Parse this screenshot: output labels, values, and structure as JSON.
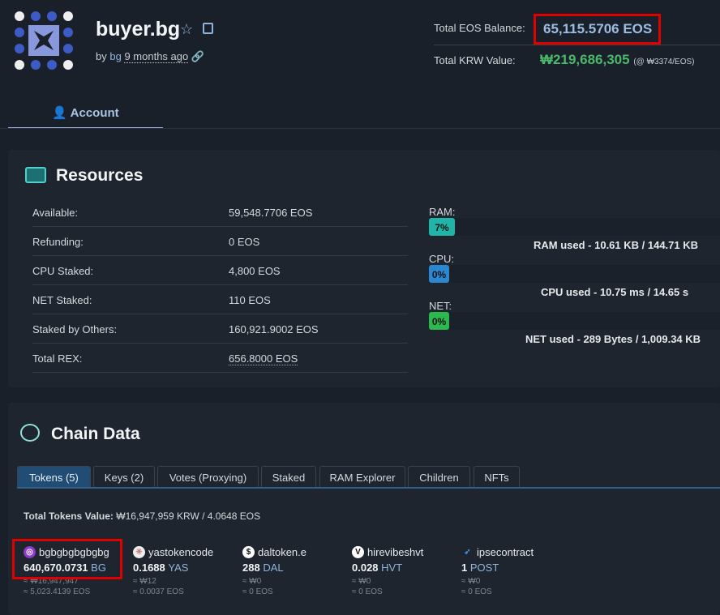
{
  "header": {
    "account": "buyer.bg",
    "by": "by",
    "creator": "bg",
    "age": "9 months ago"
  },
  "balance": {
    "eos_label": "Total EOS Balance:",
    "eos_value": "65,115.5706 EOS",
    "krw_label": "Total KRW Value:",
    "krw_value": "₩219,686,305",
    "krw_rate": "(@ ₩3374/EOS)"
  },
  "tabs": {
    "account": "Account"
  },
  "resources": {
    "title": "Resources",
    "rows": [
      {
        "label": "Available:",
        "value": "59,548.7706 EOS"
      },
      {
        "label": "Refunding:",
        "value": "0 EOS"
      },
      {
        "label": "CPU Staked:",
        "value": "4,800 EOS"
      },
      {
        "label": "NET Staked:",
        "value": "110 EOS"
      },
      {
        "label": "Staked by Others:",
        "value": "160,921.9002 EOS"
      },
      {
        "label": "Total REX:",
        "value": "656.8000 EOS"
      }
    ],
    "ram": {
      "label": "RAM:",
      "pct": "7%",
      "percent": 7,
      "used": "RAM used - 10.61 KB / 144.71 KB",
      "color": "#1fb5a8"
    },
    "cpu": {
      "label": "CPU:",
      "pct": "0%",
      "percent": 0,
      "used": "CPU used - 10.75 ms / 14.65 s",
      "color": "#2a87d0"
    },
    "net": {
      "label": "NET:",
      "pct": "0%",
      "percent": 0,
      "used": "NET used - 289 Bytes / 1,009.34 KB",
      "color": "#2bb84e"
    }
  },
  "chain": {
    "title": "Chain Data",
    "tabs": [
      "Tokens (5)",
      "Keys (2)",
      "Votes (Proxying)",
      "Staked",
      "RAM Explorer",
      "Children",
      "NFTs"
    ],
    "total_label": "Total Tokens Value:",
    "total_value": "₩16,947,959 KRW / 4.0648 EOS",
    "tokens": [
      {
        "contract": "bgbgbgbgbgbg",
        "amount": "640,670.0731",
        "symbol": "BG",
        "krw": "≈ ₩16,947,947",
        "eos": "≈ 5,023.4139 EOS"
      },
      {
        "contract": "yastokencode",
        "amount": "0.1688",
        "symbol": "YAS",
        "krw": "≈ ₩12",
        "eos": "≈ 0.0037 EOS"
      },
      {
        "contract": "daltoken.e",
        "amount": "288",
        "symbol": "DAL",
        "krw": "≈ ₩0",
        "eos": "≈ 0 EOS"
      },
      {
        "contract": "hirevibeshvt",
        "amount": "0.028",
        "symbol": "HVT",
        "krw": "≈ ₩0",
        "eos": "≈ 0 EOS"
      },
      {
        "contract": "ipsecontract",
        "amount": "1",
        "symbol": "POST",
        "krw": "≈ ₩0",
        "eos": "≈ 0 EOS"
      }
    ]
  }
}
